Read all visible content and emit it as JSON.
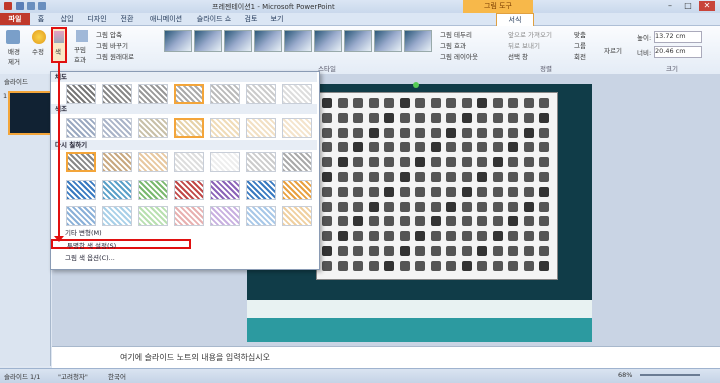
{
  "app": {
    "title": "프레젠테이션1 - Microsoft PowerPoint",
    "context_header": "그림 도구"
  },
  "tabs": [
    "파일",
    "홈",
    "삽입",
    "디자인",
    "전환",
    "애니메이션",
    "슬라이드 쇼",
    "검토",
    "보기",
    "서식"
  ],
  "ribbon": {
    "bg_remove": "배경\n제거",
    "correct": "수정",
    "color": "색",
    "artistic": "꾸밈\n효과",
    "compress": "그림 압축",
    "change": "그림 바꾸기",
    "reset": "그림 원래대로",
    "border": "그림 테두리",
    "effects": "그림 효과",
    "layout": "그림 레이아웃",
    "bring_forward": "앞으로 가져오기",
    "send_backward": "뒤로 보내기",
    "selection_pane": "선택 창",
    "align": "맞춤",
    "group": "그룹",
    "rotate": "회전",
    "crop": "자르기",
    "height_label": "높이:",
    "height_value": "13.72 cm",
    "width_label": "너비:",
    "width_value": "20.46 cm",
    "styles_group": "스타일",
    "arrange_group": "정렬",
    "size_group": "크기"
  },
  "left_panel": {
    "tab": "슬라이드",
    "slide_number": "1"
  },
  "dropdown": {
    "saturation": "채도",
    "tone": "색조",
    "recolor": "다시 칠하기",
    "more_variations": "기타 변형(M)",
    "set_transparent": "투명한 색 설정(S)",
    "picture_color_options": "그림 색 옵션(C)..."
  },
  "notes_placeholder": "여기에 슬라이드 노트의 내용을 입력하십시오",
  "status": {
    "slide": "슬라이드 1/1",
    "theme": "\"고려청자\"",
    "language": "한국어",
    "zoom": "68%"
  },
  "colors": {
    "file_tab": "#c0392b",
    "highlight": "#e01010",
    "selection": "#f3a53a",
    "slide_bg": "#103c48"
  }
}
